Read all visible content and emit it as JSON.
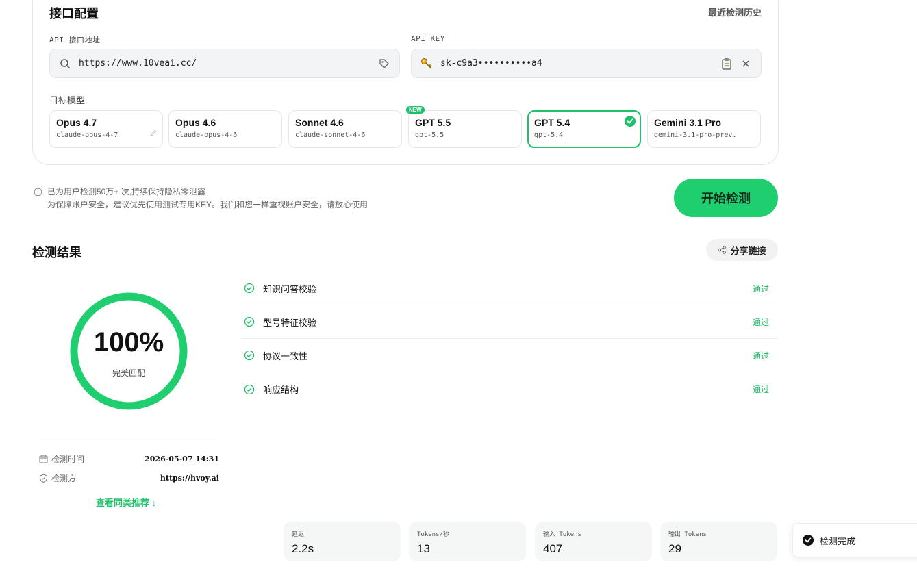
{
  "config": {
    "title": "接口配置",
    "history_link": "最近检测历史",
    "api_url": {
      "label": "API 接口地址",
      "value": "https://www.10veai.cc/"
    },
    "api_key": {
      "label": "API KEY",
      "value": "sk-c9a3••••••••••a4"
    },
    "model_label": "目标模型",
    "models": [
      {
        "name": "Opus 4.7",
        "id": "claude-opus-4-7"
      },
      {
        "name": "Opus 4.6",
        "id": "claude-opus-4-6"
      },
      {
        "name": "Sonnet 4.6",
        "id": "claude-sonnet-4-6"
      },
      {
        "name": "GPT 5.5",
        "id": "gpt-5.5",
        "badge": "NEW"
      },
      {
        "name": "GPT 5.4",
        "id": "gpt-5.4",
        "selected": true
      },
      {
        "name": "Gemini 3.1 Pro",
        "id": "gemini-3.1-pro-prev…"
      }
    ]
  },
  "notice": {
    "line1": "已为用户检测50万+ 次,持续保持隐私零泄露",
    "line2": "为保障账户安全，建议优先使用测试专用KEY。我们和您一样重视账户安全，请放心使用"
  },
  "start_button": "开始检测",
  "results": {
    "title": "检测结果",
    "share_button": "分享链接",
    "score": "100%",
    "score_fraction": 1.0,
    "score_label": "完美匹配",
    "time_label": "检测时间",
    "time_value": "2026-05-07 14:31",
    "tester_label": "检测方",
    "tester_value": "https://hvoy.ai",
    "similar_link": "查看同类推荐 ↓",
    "checks": [
      {
        "name": "知识问答校验",
        "status": "通过"
      },
      {
        "name": "型号特征校验",
        "status": "通过"
      },
      {
        "name": "协议一致性",
        "status": "通过"
      },
      {
        "name": "响应结构",
        "status": "通过"
      }
    ],
    "stats": [
      {
        "label": "延迟",
        "value": "2.2s"
      },
      {
        "label": "Tokens/秒",
        "value": "13"
      },
      {
        "label": "输入 Tokens",
        "value": "407"
      },
      {
        "label": "输出 Tokens",
        "value": "29"
      }
    ]
  },
  "toast": "检测完成",
  "colors": {
    "accent": "#1fc16b",
    "button": "#1fcf6f"
  }
}
